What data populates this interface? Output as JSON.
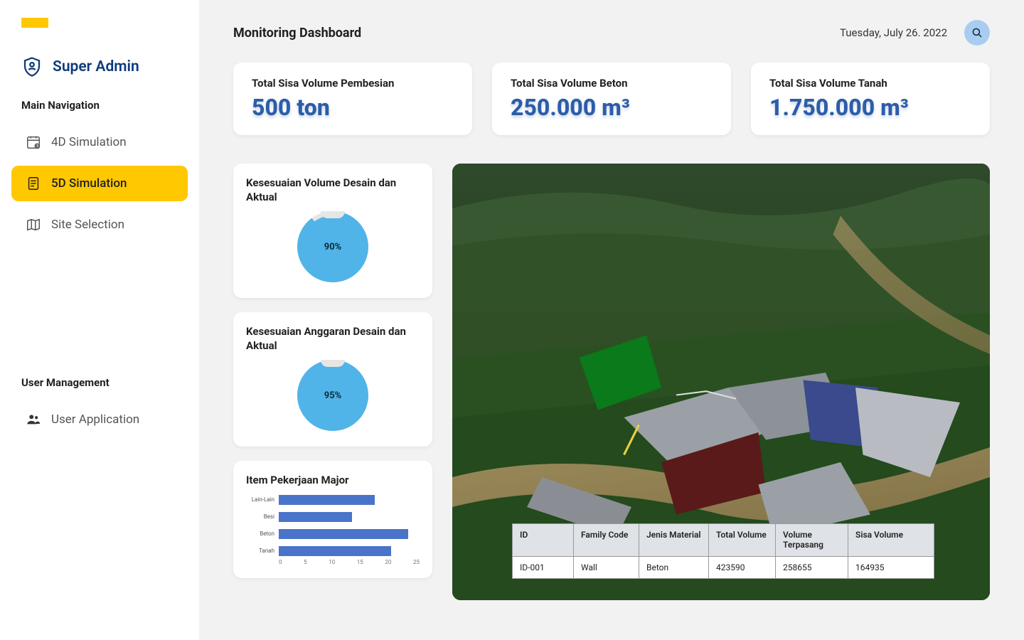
{
  "user": {
    "role_name": "Super Admin"
  },
  "sidebar": {
    "sections": {
      "main": {
        "header": "Main Navigation",
        "items": [
          {
            "label": "4D Simulation",
            "active": false
          },
          {
            "label": "5D Simulation",
            "active": true
          },
          {
            "label": "Site Selection",
            "active": false
          }
        ]
      },
      "user_mgmt": {
        "header": "User Management",
        "items": [
          {
            "label": "User Application"
          }
        ]
      }
    }
  },
  "header": {
    "title": "Monitoring Dashboard",
    "date": "Tuesday,  July 26. 2022"
  },
  "stats": [
    {
      "label": "Total Sisa Volume Pembesian",
      "value": "500 ton"
    },
    {
      "label": "Total Sisa Volume Beton",
      "value": "250.000 m³"
    },
    {
      "label": "Total Sisa Volume Tanah",
      "value": "1.750.000 m³"
    }
  ],
  "gauges": [
    {
      "title": "Kesesuaian Volume Desain dan Aktual",
      "percent": 90,
      "display": "90%"
    },
    {
      "title": "Kesesuaian Anggaran Desain dan Aktual",
      "percent": 95,
      "display": "95%"
    }
  ],
  "chart_data": {
    "type": "bar",
    "title": "Item Pekerjaan Major",
    "categories": [
      "Lain-Lain",
      "Besi",
      "Beton",
      "Tanah"
    ],
    "values": [
      17,
      13,
      23,
      20
    ],
    "xlabel": "",
    "ylabel": "",
    "xlim": [
      0,
      25
    ],
    "ticks": [
      0,
      5,
      10,
      15,
      20,
      25
    ]
  },
  "table": {
    "headers": [
      "ID",
      "Family Code",
      "Jenis Material",
      "Total Volume",
      "Volume Terpasang",
      "Sisa Volume"
    ],
    "rows": [
      [
        "ID-001",
        "Wall",
        "Beton",
        "423590",
        "258655",
        "164935"
      ]
    ]
  },
  "colors": {
    "accent_yellow": "#ffc800",
    "brand_blue": "#2d5da9",
    "gauge_fill": "#50b4e8",
    "bar_fill": "#4a74c9"
  }
}
